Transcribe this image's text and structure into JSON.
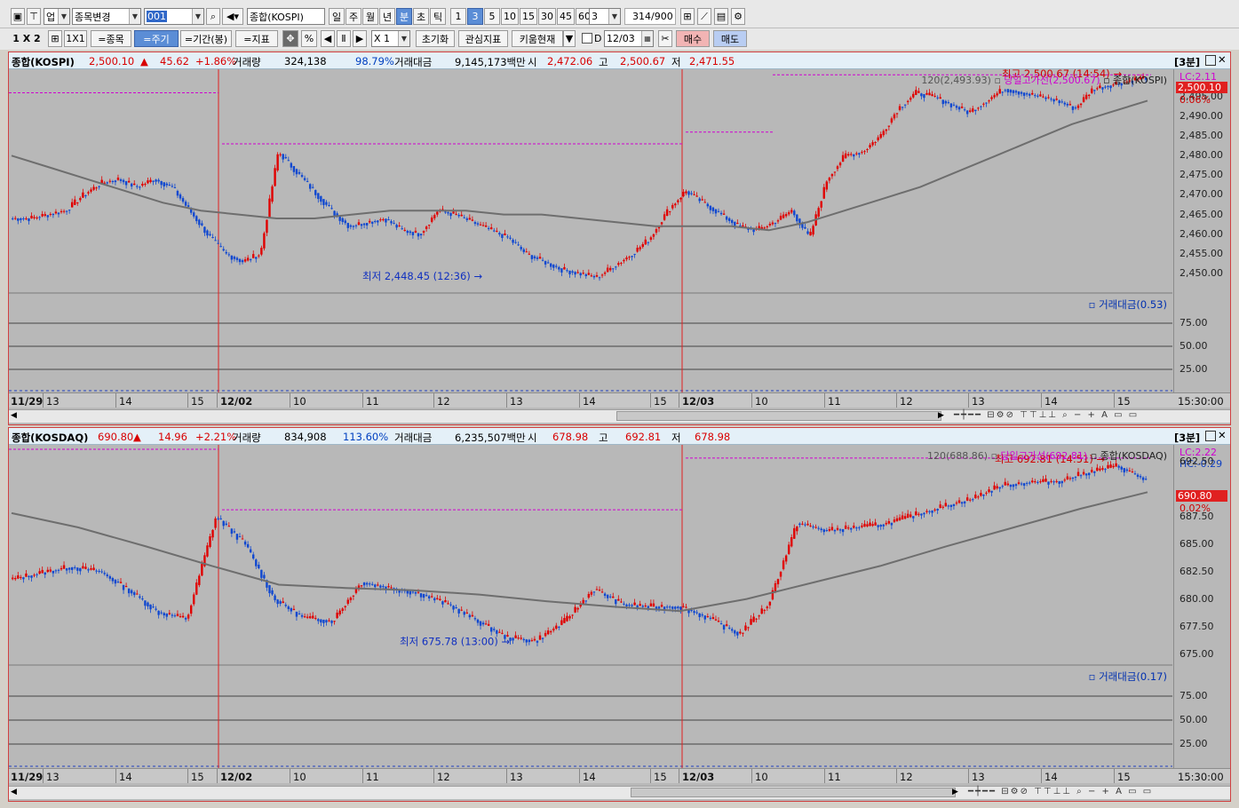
{
  "toolbar1": {
    "market_selector": "업",
    "change_symbol": "종목변경",
    "code_input": "001",
    "symbol_name": "종합(KOSPI)",
    "periods": [
      "일",
      "주",
      "월",
      "년",
      "분",
      "초",
      "틱"
    ],
    "selected_period": "분",
    "intervals": [
      "1",
      "3",
      "5",
      "10",
      "15",
      "30",
      "45",
      "60"
    ],
    "selected_interval": "3",
    "interval_input": "3",
    "count": "314",
    "count_max": "/900"
  },
  "toolbar2": {
    "layout": "1 X 2",
    "layout_1x1": "1X1",
    "eq_symbol": "=종목",
    "eq_period": "=주기",
    "eq_range": "=기간(봉)",
    "eq_indicator": "=지표",
    "scale": "X 1",
    "reset": "초기화",
    "watch_indicator": "관심지표",
    "kiwoom_now": "키움현재",
    "d_label": "D",
    "date": "12/03",
    "buy": "매수",
    "sell": "매도"
  },
  "kospi": {
    "name": "종합(KOSPI)",
    "price": "2,500.10",
    "arrow": "▲",
    "change": "45.62",
    "change_pct": "+1.86%",
    "vol_label": "거래량",
    "volume": "324,138",
    "vol_pct": "98.79%",
    "amt_label": "거래대금",
    "amount": "9,145,173백만",
    "open_label": "시",
    "open": "2,472.06",
    "high_label": "고",
    "high": "2,500.67",
    "low_label": "저",
    "low": "2,471.55",
    "period_tag": "[3분]",
    "ma_label": "120(2,493.93)",
    "day_high_line": "당일고가선(2,500.67)",
    "legend_name": "종합(KOSPI)",
    "lc": "LC:2.11",
    "hc": "HC:0.00",
    "price_tag": "2,500.10",
    "pct_tag": "0.06%",
    "high_annot": "최고 2,500.67 (14:54)",
    "low_annot": "최저 2,448.45 (12:36)",
    "sub_label": "거래대금(0.53)",
    "y_ticks": [
      "2,495.00",
      "2,490.00",
      "2,485.00",
      "2,480.00",
      "2,475.00",
      "2,470.00",
      "2,465.00",
      "2,460.00",
      "2,455.00",
      "2,450.00"
    ],
    "sub_ticks": [
      "75.00",
      "50.00",
      "25.00"
    ],
    "time_label": "15:30:00"
  },
  "kosdaq": {
    "name": "종합(KOSDAQ)",
    "price": "690.80",
    "arrow": "▲",
    "change": "14.96",
    "change_pct": "+2.21%",
    "vol_label": "거래량",
    "volume": "834,908",
    "vol_pct": "113.60%",
    "amt_label": "거래대금",
    "amount": "6,235,507백만",
    "open_label": "시",
    "open": "678.98",
    "high_label": "고",
    "high": "692.81",
    "low_label": "저",
    "low": "678.98",
    "period_tag": "[3분]",
    "ma_label": "120(688.86)",
    "day_high_line": "당일고가선(692.81)",
    "legend_name": "종합(KOSDAQ)",
    "lc": "LC:2.22",
    "hc": "HC:-0.29",
    "price_tag": "690.80",
    "pct_tag": "0.02%",
    "high_annot": "최고 692.81 (14:51)",
    "low_annot": "최저 675.78 (13:00)",
    "sub_label": "거래대금(0.17)",
    "y_ticks": [
      "692.50",
      "687.50",
      "685.00",
      "682.50",
      "680.00",
      "677.50",
      "675.00"
    ],
    "sub_ticks": [
      "75.00",
      "50.00",
      "25.00"
    ],
    "time_label": "15:30:00"
  },
  "x_labels": [
    "11/29",
    "13",
    "14",
    "15",
    "12/02",
    "10",
    "11",
    "12",
    "13",
    "14",
    "15",
    "12/03",
    "10",
    "11",
    "12",
    "13",
    "14",
    "15"
  ],
  "colors": {
    "up": "#e00000",
    "down": "#1048d0",
    "ma": "#6e6e6e",
    "high_line": "#d000d0",
    "grid": "#a4a4a4"
  },
  "chart_data": [
    {
      "type": "candlestick",
      "title": "종합(KOSPI) 3분",
      "ylim": [
        2445,
        2502
      ],
      "series": [
        {
          "name": "종합(KOSPI)",
          "values": [
            2464,
            2464,
            2465,
            2466,
            2470,
            2473,
            2474,
            2472,
            2474,
            2472,
            2466,
            2460,
            2455,
            2453,
            2455,
            2481,
            2476,
            2471,
            2466,
            2462,
            2463,
            2464,
            2461,
            2460,
            2466,
            2465,
            2463,
            2461,
            2459,
            2455,
            2453,
            2451,
            2450,
            2449,
            2452,
            2455,
            2459,
            2466,
            2471,
            2468,
            2465,
            2462,
            2461,
            2463,
            2466,
            2459,
            2474,
            2480,
            2481,
            2485,
            2492,
            2496,
            2495,
            2493,
            2491,
            2494,
            2497,
            2496,
            2495,
            2494,
            2492,
            2497,
            2498,
            2499,
            2500
          ]
        },
        {
          "name": "120",
          "values": [
            2480,
            2477,
            2474,
            2471,
            2468,
            2466,
            2465,
            2464,
            2464,
            2465,
            2466,
            2466,
            2466,
            2465,
            2465,
            2464,
            2463,
            2462,
            2462,
            2462,
            2461,
            2463,
            2466,
            2469,
            2472,
            2476,
            2480,
            2484,
            2488,
            2491,
            2494
          ]
        }
      ]
    },
    {
      "type": "candlestick",
      "title": "종합(KOSDAQ) 3분",
      "ylim": [
        674,
        694
      ],
      "series": [
        {
          "name": "종합(KOSDAQ)",
          "values": [
            681.8,
            682.4,
            682.9,
            682.5,
            680.8,
            678.8,
            678.2,
            687.5,
            685,
            680,
            678.3,
            678,
            681.5,
            681,
            680.5,
            679.5,
            678,
            676.5,
            676.2,
            678,
            680.9,
            679.5,
            679.3,
            679.3,
            678.2,
            676.8,
            679.5,
            686.9,
            686.2,
            686.5,
            686.8,
            687.6,
            688.4,
            689.1,
            690.3,
            690.6,
            690.7,
            691.5,
            692.1,
            690.8
          ]
        },
        {
          "name": "120",
          "values": [
            687.8,
            686.5,
            684.8,
            683,
            681.3,
            681,
            680.8,
            680.4,
            679.8,
            679.3,
            678.9,
            680,
            681.5,
            683,
            684.8,
            686.5,
            688.2,
            689.7
          ]
        }
      ]
    }
  ]
}
